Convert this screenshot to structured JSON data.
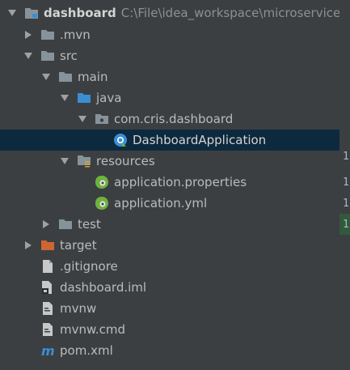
{
  "tree": {
    "root": {
      "label": "dashboard",
      "path": "C:\\File\\idea_workspace\\microservice\\d"
    },
    "mvn": {
      "label": ".mvn"
    },
    "src": {
      "label": "src"
    },
    "main": {
      "label": "main"
    },
    "java": {
      "label": "java"
    },
    "package": {
      "label": "com.cris.dashboard"
    },
    "app_class": {
      "label": "DashboardApplication"
    },
    "resources": {
      "label": "resources"
    },
    "props": {
      "label": "application.properties"
    },
    "yml": {
      "label": "application.yml"
    },
    "test": {
      "label": "test"
    },
    "target": {
      "label": "target"
    },
    "gitignore": {
      "label": ".gitignore"
    },
    "iml": {
      "label": "dashboard.iml"
    },
    "mvnw": {
      "label": "mvnw"
    },
    "mvnw_cmd": {
      "label": "mvnw.cmd"
    },
    "pom": {
      "label": "pom.xml"
    }
  },
  "gutter": {
    "marks": [
      "1",
      "1",
      "1",
      "1"
    ]
  },
  "colors": {
    "background": "#3c3f41",
    "selection": "#0d293e",
    "folder": "#87939a",
    "source_folder": "#3b8ed4",
    "resources_folder": "#87939a",
    "excluded_folder": "#cc6633",
    "spring": "#6db33f"
  }
}
